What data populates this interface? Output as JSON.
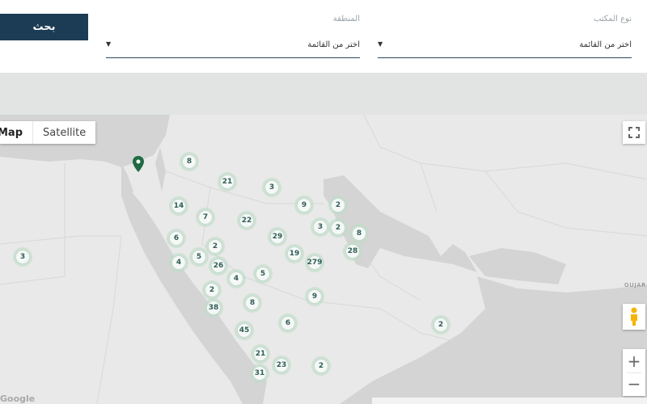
{
  "search": {
    "button_label": "بحث"
  },
  "filters": {
    "office_type": {
      "label": "نوع المكتب",
      "value": "اختر من القائمة"
    },
    "region": {
      "label": "المنطقة",
      "value": "اختر من القائمة"
    }
  },
  "map": {
    "type_controls": {
      "map_label": "Map",
      "satellite_label": "Satellite"
    },
    "place_label": "GUJAR",
    "brand": "Google",
    "clusters": [
      "8",
      "21",
      "3",
      "9",
      "2",
      "14",
      "7",
      "22",
      "3",
      "2",
      "8",
      "6",
      "2",
      "29",
      "3",
      "4",
      "5",
      "26",
      "19",
      "279",
      "28",
      "4",
      "5",
      "2",
      "9",
      "38",
      "8",
      "45",
      "6",
      "2",
      "21",
      "23",
      "2",
      "31"
    ]
  }
}
